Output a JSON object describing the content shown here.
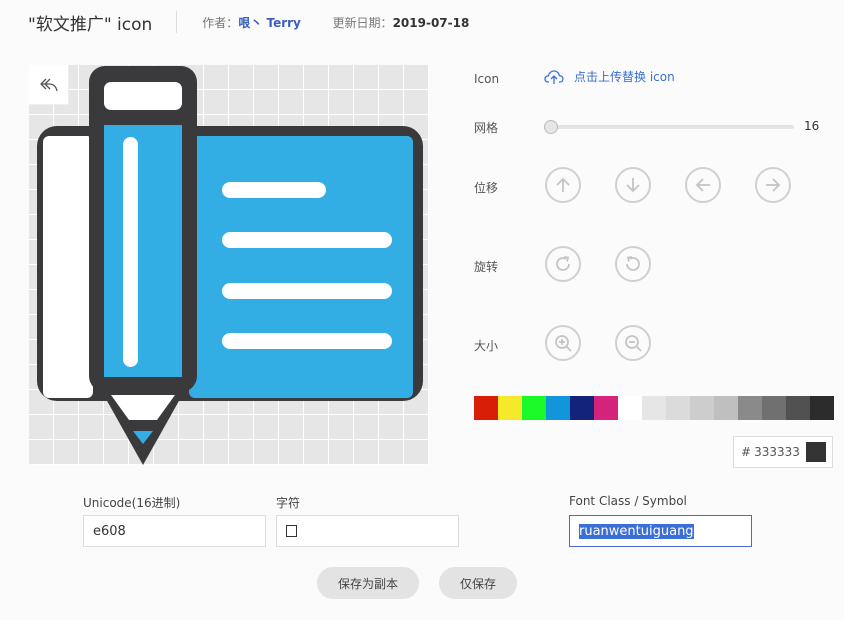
{
  "header": {
    "title": "\"软文推广\" icon",
    "author_label": "作者：",
    "author": "哏丶 Terry",
    "date_label": "更新日期：",
    "date": "2019-07-18"
  },
  "icon_colors": {
    "outline": "#3a3a3c",
    "fill": "#33aee5",
    "white": "#ffffff"
  },
  "panel": {
    "icon_label": "Icon",
    "upload_label": "点击上传替换 icon",
    "grid_label": "网格",
    "grid_value": "16",
    "move_label": "位移",
    "rotate_label": "旋转",
    "size_label": "大小"
  },
  "palette": [
    "#d81e06",
    "#f4ea2a",
    "#1afa29",
    "#1296db",
    "#13227a",
    "#d4237a",
    "#ffffff",
    "#e6e6e6",
    "#dbdbdb",
    "#cdcdcd",
    "#bfbfbf",
    "#8a8a8a",
    "#707070",
    "#515151",
    "#2c2c2c"
  ],
  "color": {
    "hash": "#",
    "hex": "333333",
    "current": "#333333"
  },
  "fields": {
    "unicode_label": "Unicode(16进制)",
    "unicode_value": "e608",
    "char_label": "字符",
    "char_value": "",
    "fontclass_label": "Font Class / Symbol",
    "fontclass_value": "ruanwentuiguang"
  },
  "buttons": {
    "save_copy": "保存为副本",
    "save_only": "仅保存"
  }
}
